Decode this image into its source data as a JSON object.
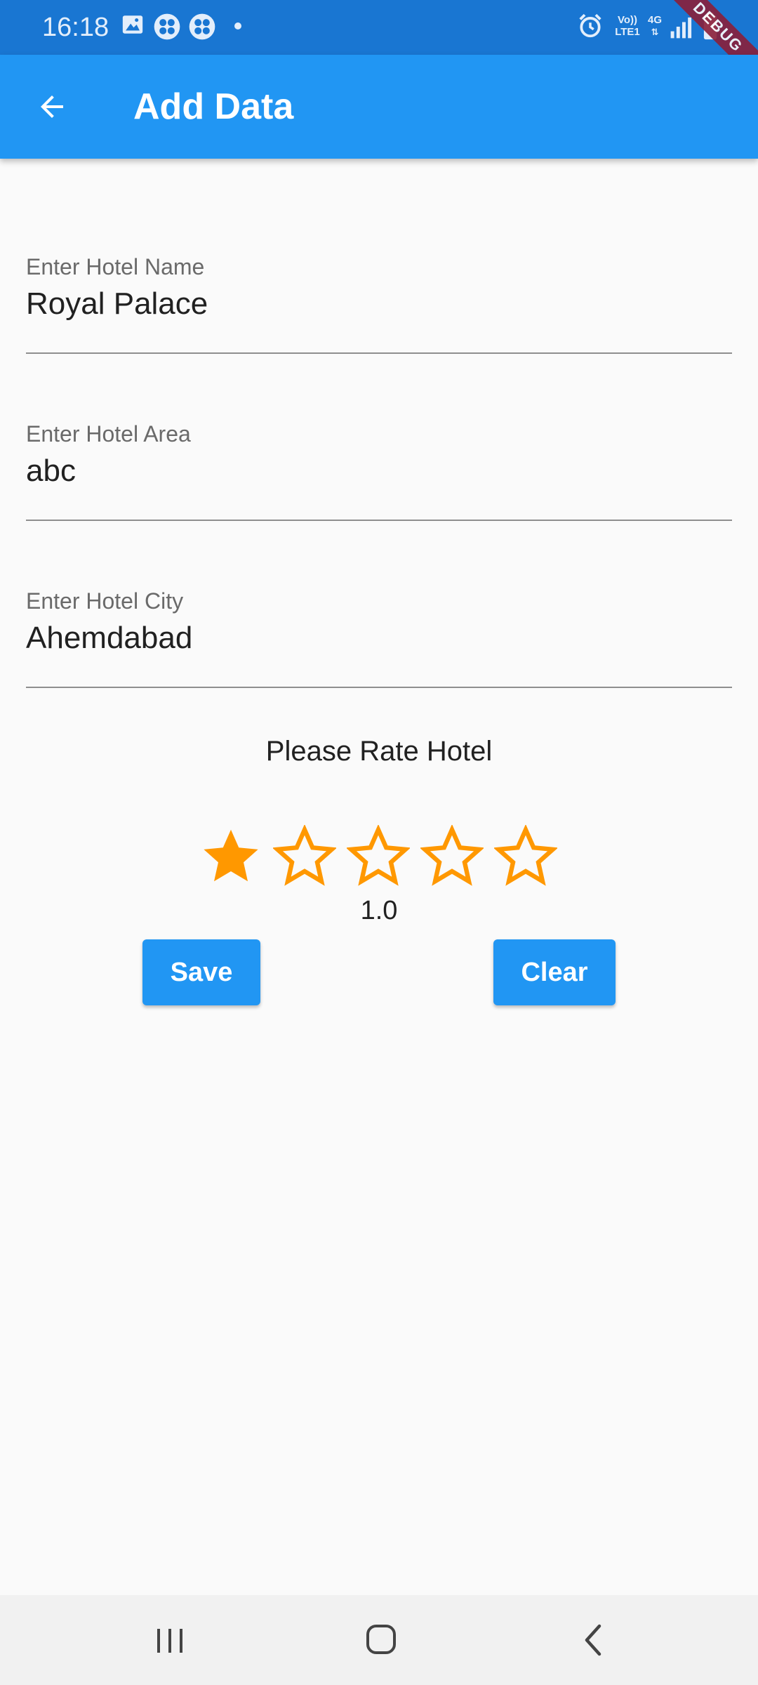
{
  "status_bar": {
    "time": "16:18",
    "network_top": "Vo))",
    "network_bottom": "LTE1",
    "network_type": "4G",
    "icons": [
      "image-icon",
      "pinwheel-icon",
      "pinwheel-icon",
      "dot-icon",
      "alarm-icon",
      "signal-icon",
      "battery-icon"
    ]
  },
  "debug_banner": "DEBUG",
  "app_bar": {
    "title": "Add Data",
    "back_icon": "arrow-left-icon"
  },
  "form": {
    "hotel_name": {
      "label": "Enter Hotel Name",
      "value": "Royal Palace"
    },
    "hotel_area": {
      "label": "Enter Hotel Area",
      "value": "abc"
    },
    "hotel_city": {
      "label": "Enter Hotel City",
      "value": "Ahemdabad"
    }
  },
  "rating": {
    "title": "Please Rate Hotel",
    "value": 1,
    "max": 5,
    "value_text": "1.0",
    "star_color": "#ff9800"
  },
  "buttons": {
    "save_label": "Save",
    "clear_label": "Clear"
  },
  "nav_bar": {
    "icons": [
      "recents-icon",
      "home-icon",
      "back-icon"
    ]
  },
  "colors": {
    "primary": "#2196f3",
    "status_bar": "#1976d2",
    "background": "#fafafa"
  }
}
